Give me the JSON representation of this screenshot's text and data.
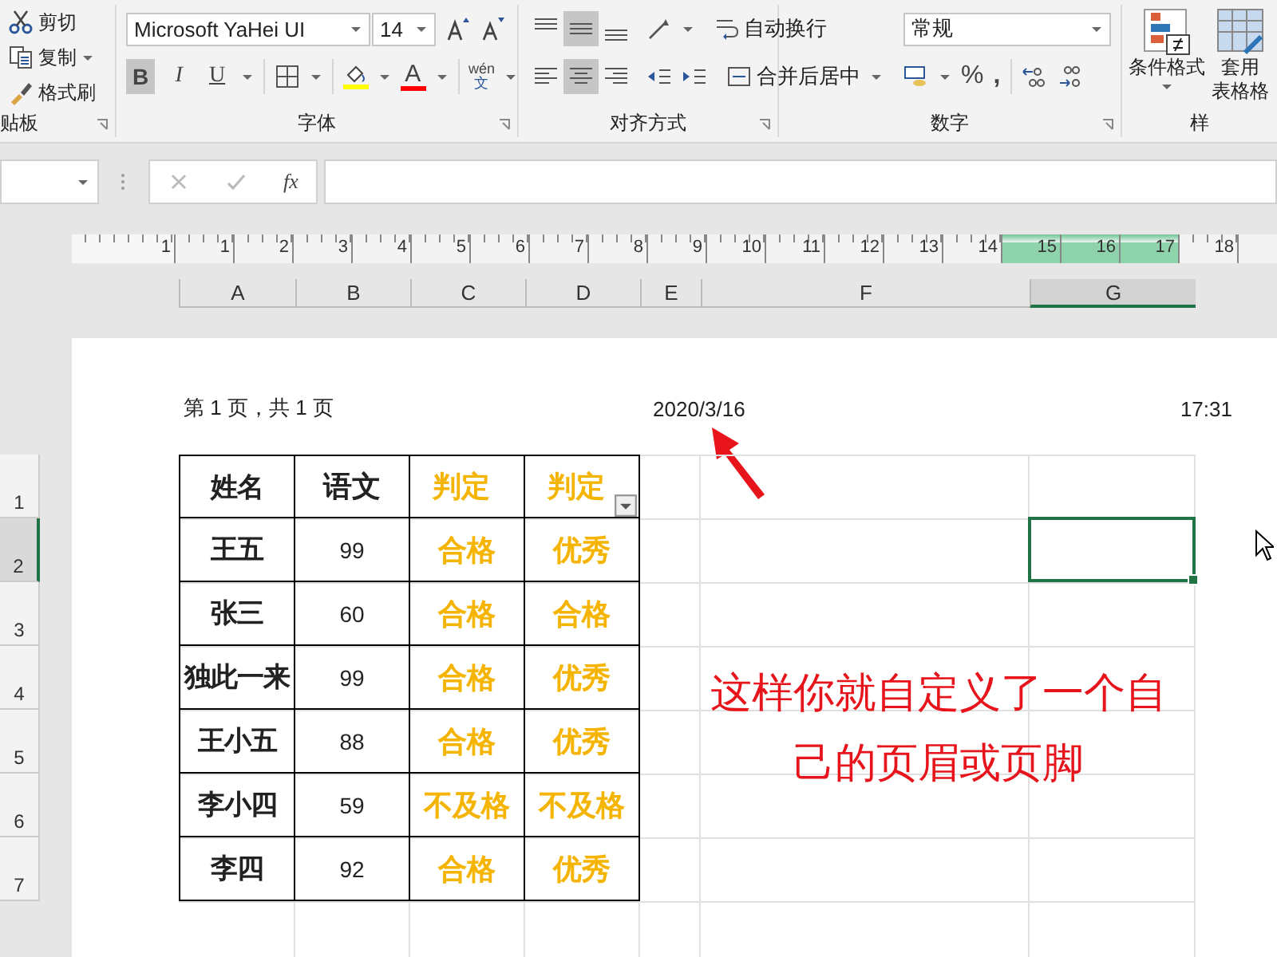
{
  "ribbon": {
    "clipboard": {
      "items": [
        {
          "kind": "cut",
          "label": "剪切"
        },
        {
          "kind": "copy",
          "label": "复制"
        },
        {
          "kind": "painter",
          "label": "格式刷"
        }
      ],
      "label": "贴板"
    },
    "font": {
      "family": "Microsoft YaHei UI",
      "size": "14",
      "styles": [
        {
          "label": "B",
          "kind": "bold",
          "selected": true
        },
        {
          "label": "I",
          "kind": "italic",
          "selected": false
        },
        {
          "label": "U",
          "kind": "underline",
          "selected": false
        }
      ],
      "font_color": {
        "label": "A"
      },
      "phonetic": {
        "top": "wén",
        "bottom": "文"
      },
      "label": "字体"
    },
    "alignment": {
      "vertical": [
        {
          "kind": "top",
          "selected": false
        },
        {
          "kind": "middle",
          "selected": true
        },
        {
          "kind": "bottom",
          "selected": false
        }
      ],
      "horizontal": [
        {
          "kind": "left",
          "selected": false
        },
        {
          "kind": "center",
          "selected": true
        },
        {
          "kind": "right",
          "selected": false
        }
      ],
      "wrap_text": "自动换行",
      "merge": "合并后居中",
      "label": "对齐方式"
    },
    "number": {
      "format": "常规",
      "percent": "%",
      "comma": ",",
      "label": "数字"
    },
    "styles": {
      "conditional": "条件格式",
      "table_format": [
        "套用",
        "表格格"
      ],
      "label": "样"
    }
  },
  "formula_bar": {
    "fx": "fx"
  },
  "ruler": [
    {
      "label": "1",
      "selected": false
    },
    {
      "label": "1",
      "selected": false
    },
    {
      "label": "2",
      "selected": false
    },
    {
      "label": "3",
      "selected": false
    },
    {
      "label": "4",
      "selected": false
    },
    {
      "label": "5",
      "selected": false
    },
    {
      "label": "6",
      "selected": false
    },
    {
      "label": "7",
      "selected": false
    },
    {
      "label": "8",
      "selected": false
    },
    {
      "label": "9",
      "selected": false
    },
    {
      "label": "10",
      "selected": false
    },
    {
      "label": "11",
      "selected": false
    },
    {
      "label": "12",
      "selected": false
    },
    {
      "label": "13",
      "selected": false
    },
    {
      "label": "14",
      "selected": false
    },
    {
      "label": "15",
      "selected": true
    },
    {
      "label": "16",
      "selected": true
    },
    {
      "label": "17",
      "selected": true
    },
    {
      "label": "18",
      "selected": false
    }
  ],
  "columns": [
    {
      "label": "A",
      "selected": false
    },
    {
      "label": "B",
      "selected": false
    },
    {
      "label": "C",
      "selected": false
    },
    {
      "label": "D",
      "selected": false
    },
    {
      "label": "E",
      "selected": false
    },
    {
      "label": "F",
      "selected": false
    },
    {
      "label": "G",
      "selected": true
    }
  ],
  "rows": [
    {
      "label": "1",
      "selected": false
    },
    {
      "label": "2",
      "selected": true
    },
    {
      "label": "3",
      "selected": false
    },
    {
      "label": "4",
      "selected": false
    },
    {
      "label": "5",
      "selected": false
    },
    {
      "label": "6",
      "selected": false
    },
    {
      "label": "7",
      "selected": false
    }
  ],
  "page_header": {
    "left": "第 1 页，共 1 页",
    "center": "2020/3/16",
    "right": "17:31"
  },
  "table": {
    "columns": [
      {
        "header": "姓名",
        "kind": "name",
        "filter": false
      },
      {
        "header": "语文",
        "kind": "score",
        "filter": false
      },
      {
        "header": "判定",
        "kind": "result",
        "filter": false
      },
      {
        "header": "判定",
        "kind": "result",
        "filter": true
      }
    ],
    "rows": [
      [
        "王五",
        "99",
        "合格",
        "优秀"
      ],
      [
        "张三",
        "60",
        "合格",
        "合格"
      ],
      [
        "独此一来",
        "99",
        "合格",
        "优秀"
      ],
      [
        "王小五",
        "88",
        "合格",
        "优秀"
      ],
      [
        "李小四",
        "59",
        "不及格",
        "不及格"
      ],
      [
        "李四",
        "92",
        "合格",
        "优秀"
      ]
    ]
  },
  "annotation": "这样你就自定义了一个自己的页眉或页脚"
}
